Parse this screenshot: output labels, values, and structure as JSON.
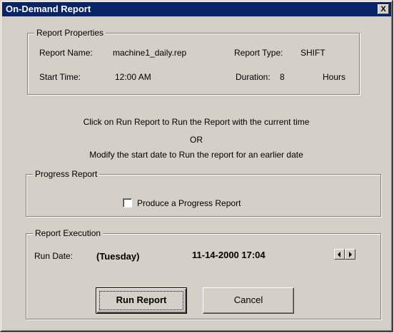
{
  "window": {
    "title": "On-Demand Report",
    "close_label": "X"
  },
  "properties": {
    "legend": "Report Properties",
    "report_name_label": "Report Name:",
    "report_name_value": "machine1_daily.rep",
    "report_type_label": "Report Type:",
    "report_type_value": "SHIFT",
    "start_time_label": "Start Time:",
    "start_time_value": "12:00 AM",
    "duration_label": "Duration:",
    "duration_value": "8",
    "duration_unit": "Hours"
  },
  "instructions": {
    "line1": "Click on Run Report to Run the Report with the current time",
    "line2": "OR",
    "line3": "Modify the start date to Run the report for an earlier date"
  },
  "progress": {
    "legend": "Progress Report",
    "checkbox_label": "Produce a Progress Report",
    "checked": false
  },
  "execution": {
    "legend": "Report Execution",
    "run_date_label": "Run Date:",
    "day_value": "(Tuesday)",
    "datetime_value": "11-14-2000 17:04"
  },
  "buttons": {
    "run_label": "Run Report",
    "cancel_label": "Cancel"
  }
}
